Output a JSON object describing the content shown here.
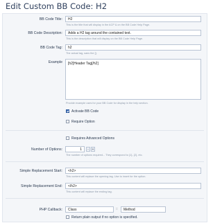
{
  "header": {
    "title": "Edit Custom BB Code: H2"
  },
  "fields": {
    "title": {
      "label": "BB Code Title:",
      "value": "H2",
      "hint": "This is the title that will display in the ACP & on the BB Code Help Page."
    },
    "description": {
      "label": "BB Code Description:",
      "value": "Adds a H2 tag around the contained text.",
      "hint": "This is the description that will display on the BB Code Help Page."
    },
    "tag": {
      "label": "BB Code Tag:",
      "value": "h2",
      "hint": "The actual tag, sans the []."
    },
    "example": {
      "label": "Example",
      "value": "[h2]Header Tag[/h2]",
      "hint": "Provide example uses for your BB Code for display in the help section."
    },
    "activate": {
      "label": "Activate BB Code",
      "checked": true
    },
    "require_option": {
      "label": "Require Option",
      "checked": false
    },
    "requires_advanced": {
      "label": "Requires Advanced Options",
      "checked": false
    },
    "num_options": {
      "label": "Number of Options:",
      "value": "1",
      "hint": "The number of options required... They correspond to {1}, {2}, etc.",
      "decrement": "-",
      "increment": "+"
    },
    "replacement_start": {
      "label": "Simple Replacement Start:",
      "value": "<h2>",
      "hint": "This content will replace the opening tag. Use to insert for the option."
    },
    "replacement_end": {
      "label": "Simple Replacement End:",
      "value": "</h2>",
      "hint": "This content will replace the ending tag."
    },
    "php_callback": {
      "label": "PHP Callback:",
      "class_value": "Class",
      "separator": "::",
      "method_value": "Method"
    },
    "plain_output": {
      "label": "Return plain output if no option is specified.",
      "checked": false
    }
  },
  "colors": {
    "title": "#2e3f5c",
    "checkbox_checked": "#3b6bb6"
  }
}
